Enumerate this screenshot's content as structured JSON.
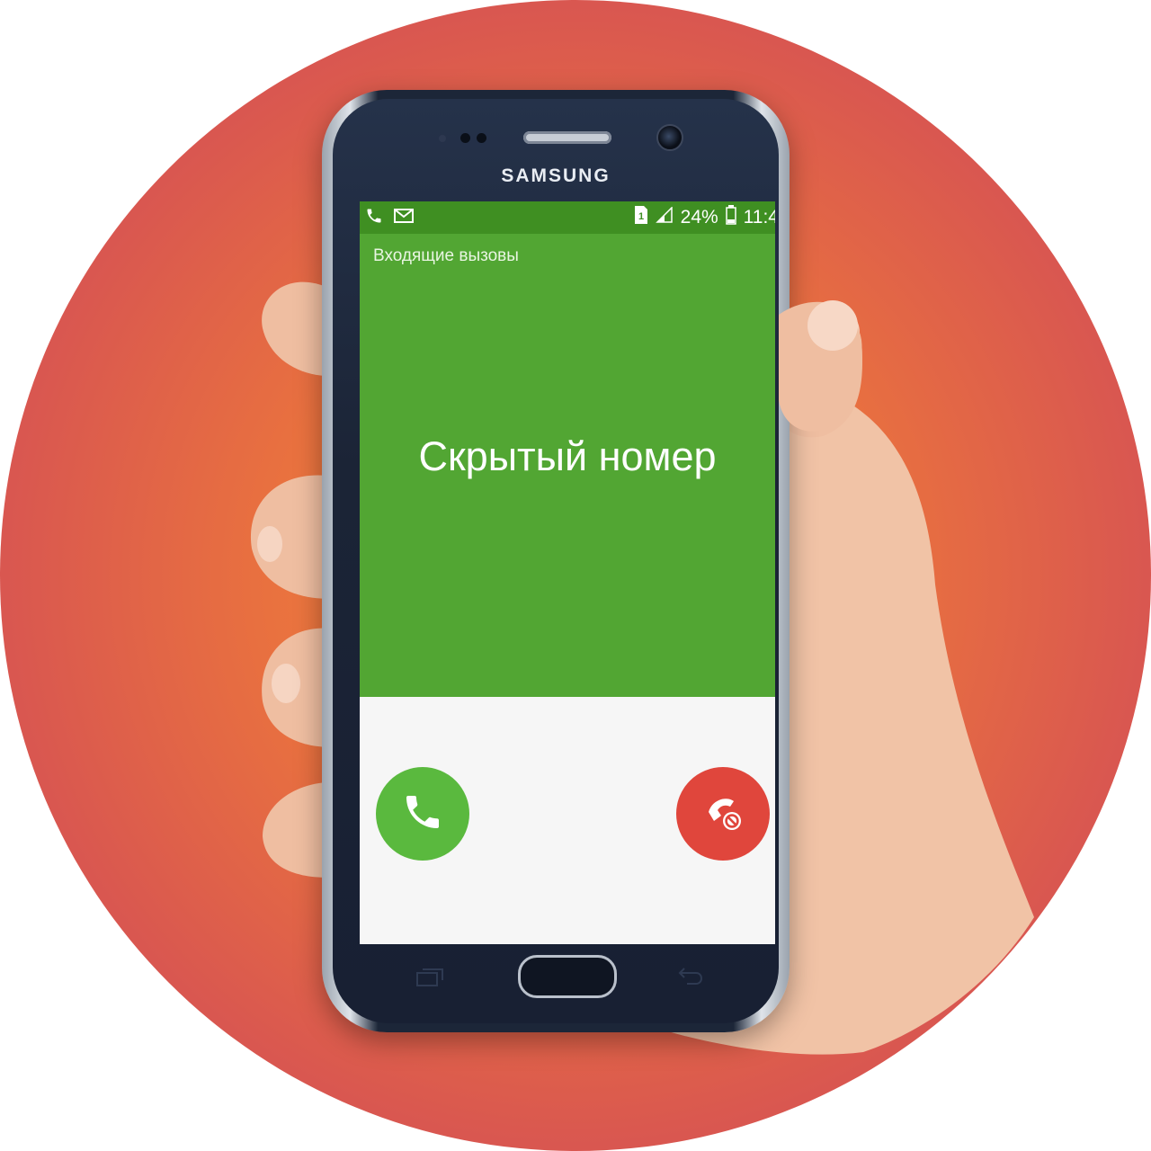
{
  "device": {
    "brand": "SAMSUNG"
  },
  "status_bar": {
    "left_icons": [
      "phone-icon",
      "envelope-icon"
    ],
    "sim_icon": "sim-1-icon",
    "signal_icon": "signal-icon",
    "battery_percent": "24%",
    "battery_icon": "battery-icon",
    "time": "11:4"
  },
  "call": {
    "label": "Входящие вызовы",
    "caller": "Скрытый номер"
  },
  "actions": {
    "accept_icon": "phone-accept-icon",
    "decline_icon": "phone-reject-icon"
  },
  "colors": {
    "background_circle": "#d95750",
    "status_bar": "#3f8f22",
    "call_screen": "#52a633",
    "accept": "#5ab93e",
    "decline": "#e0463c"
  }
}
